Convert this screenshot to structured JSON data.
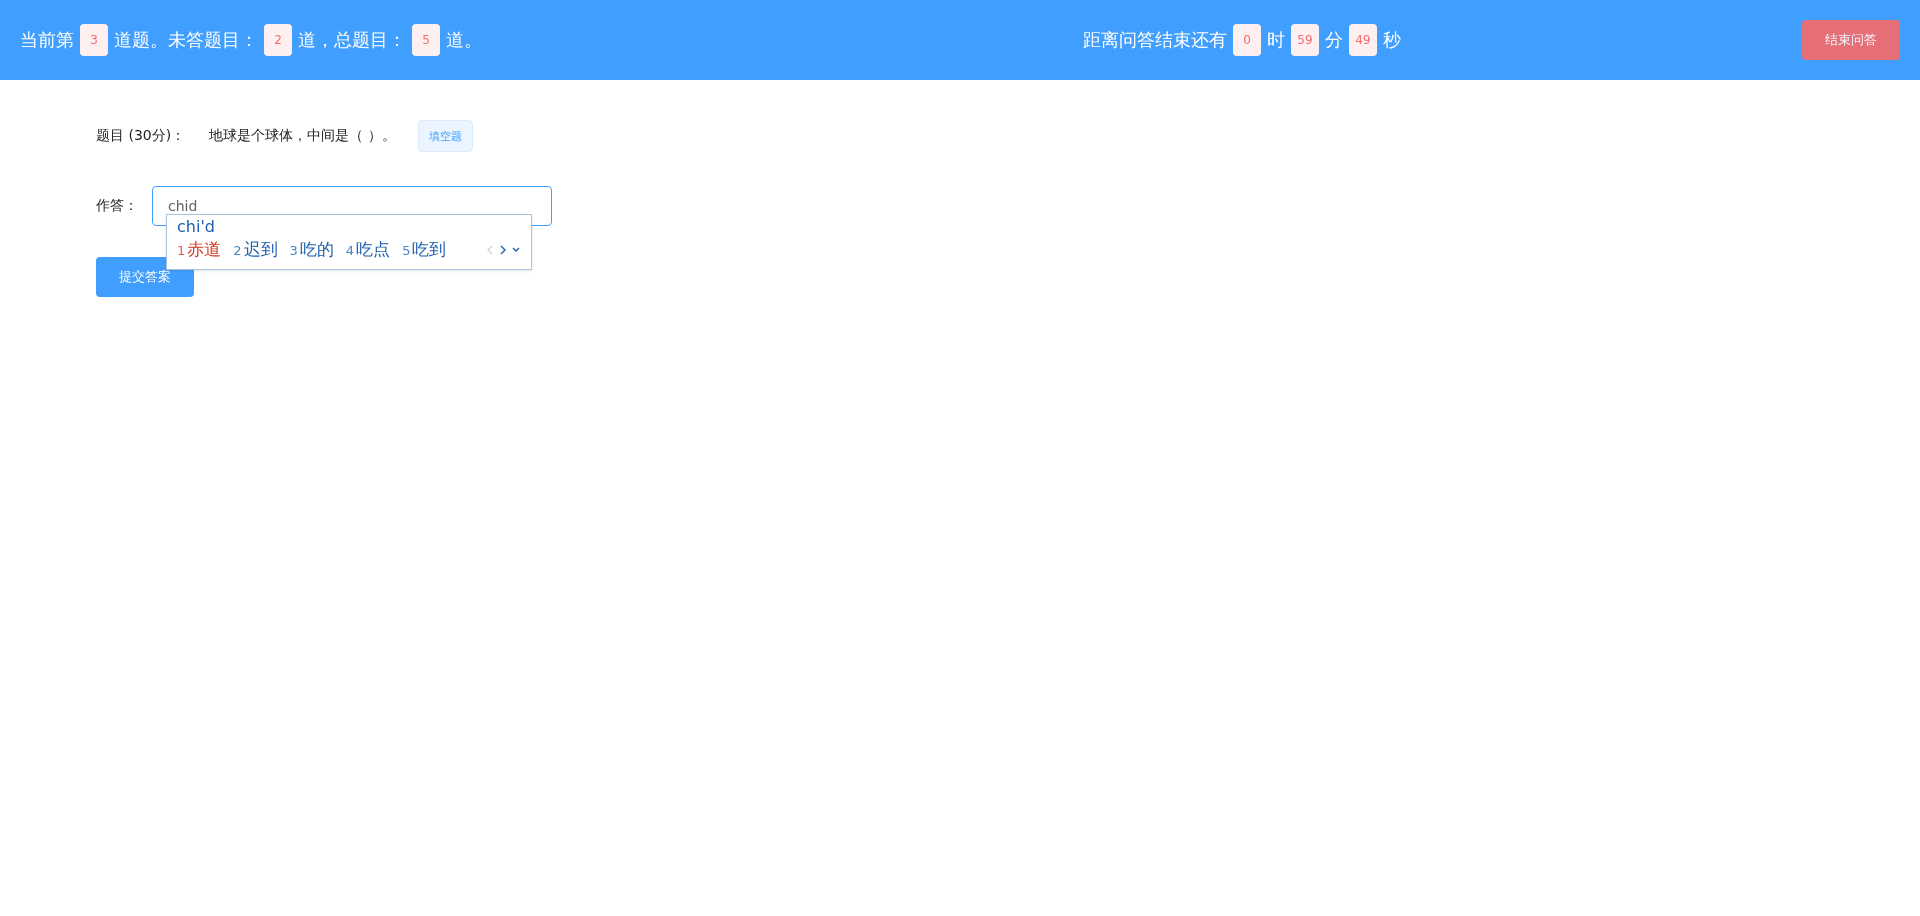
{
  "header": {
    "progress": [
      {
        "kind": "text",
        "text": "当前第"
      },
      {
        "kind": "count",
        "text": "3"
      },
      {
        "kind": "text",
        "text": "道题。未答题目："
      },
      {
        "kind": "count",
        "text": "2"
      },
      {
        "kind": "text",
        "text": "道，总题目："
      },
      {
        "kind": "count",
        "text": "5"
      },
      {
        "kind": "text",
        "text": "道。"
      }
    ],
    "timer": [
      {
        "kind": "text",
        "text": "距离问答结束还有"
      },
      {
        "kind": "count",
        "text": "0"
      },
      {
        "kind": "text",
        "text": "时"
      },
      {
        "kind": "count",
        "text": "59"
      },
      {
        "kind": "text",
        "text": "分"
      },
      {
        "kind": "count",
        "text": "49"
      },
      {
        "kind": "text",
        "text": "秒"
      }
    ],
    "end_button": "结束问答"
  },
  "question": {
    "label": "题目 (30分)：",
    "text": "地球是个球体，中间是（ ）。",
    "type_tag": "填空题"
  },
  "answer": {
    "label": "作答：",
    "value": "chid"
  },
  "ime": {
    "composition": "chi'd",
    "candidates": [
      {
        "index": "1",
        "text": "赤道",
        "selected": true
      },
      {
        "index": "2",
        "text": "迟到",
        "selected": false
      },
      {
        "index": "3",
        "text": "吃的",
        "selected": false
      },
      {
        "index": "4",
        "text": "吃点",
        "selected": false
      },
      {
        "index": "5",
        "text": "吃到",
        "selected": false
      }
    ]
  },
  "submit_button": "提交答案"
}
